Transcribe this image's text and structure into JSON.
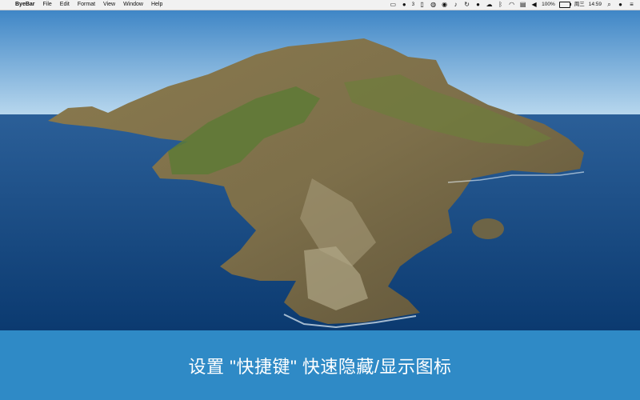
{
  "menubar": {
    "app_name": "ByeBar",
    "menus": [
      "File",
      "Edit",
      "Format",
      "View",
      "Window",
      "Help"
    ],
    "tray": {
      "badge_count": "3",
      "battery_percent": "100%",
      "day": "周三",
      "time": "14:59"
    }
  },
  "banner": {
    "text": "设置 \"快捷键\" 快速隐藏/显示图标"
  },
  "colors": {
    "banner_bg": "#2f8ac6",
    "menubar_bg": "#f1f1f1"
  }
}
